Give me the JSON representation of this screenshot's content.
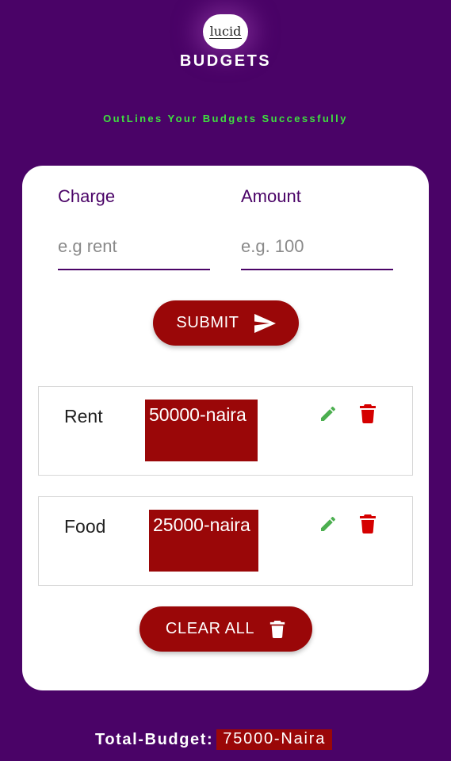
{
  "header": {
    "logo_text": "lucid",
    "title": "BUDGETS",
    "tagline": "OutLines Your Budgets Successfully"
  },
  "form": {
    "charge": {
      "label": "Charge",
      "placeholder": "e.g rent",
      "value": ""
    },
    "amount": {
      "label": "Amount",
      "placeholder": "e.g. 100",
      "value": ""
    },
    "submit_label": "SUBMIT",
    "submit_icon": "send-icon"
  },
  "expenses": [
    {
      "charge": "Rent",
      "amount": "50000-naira"
    },
    {
      "charge": "Food",
      "amount": "25000-naira"
    }
  ],
  "clear_all_label": "CLEAR ALL",
  "total": {
    "label": "Total-Budget:",
    "value": "75000-Naira"
  },
  "colors": {
    "background": "#4a0367",
    "accent": "#9a0708",
    "tagline": "#3fe03f",
    "edit_icon": "#4caf50",
    "delete_icon": "#d50000"
  }
}
